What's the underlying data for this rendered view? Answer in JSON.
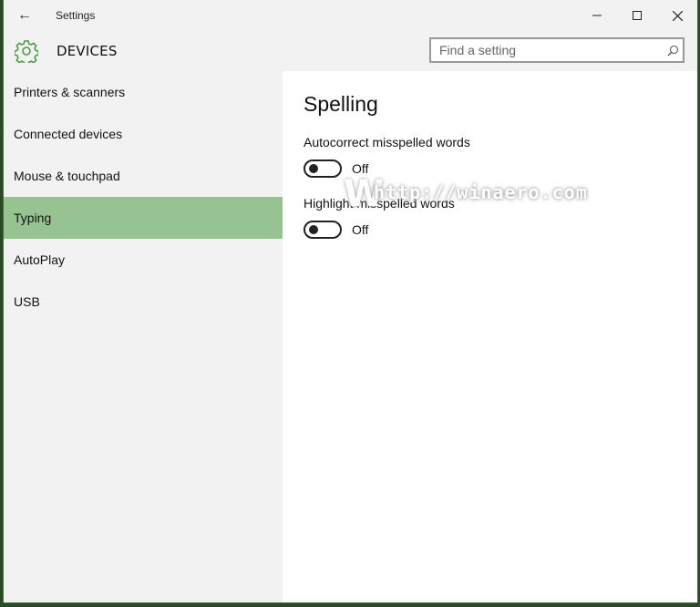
{
  "window": {
    "title": "Settings",
    "back_icon": "arrow-left-icon",
    "minimize": "–",
    "maximize": "☐",
    "close": "✕"
  },
  "header": {
    "section_title": "DEVICES",
    "icon": "gear-icon",
    "accent": "#4c9a44"
  },
  "search": {
    "placeholder": "Find a setting",
    "value": ""
  },
  "sidebar": {
    "items": [
      {
        "label": "Printers & scanners"
      },
      {
        "label": "Connected devices"
      },
      {
        "label": "Mouse & touchpad"
      },
      {
        "label": "Typing",
        "selected": true
      },
      {
        "label": "AutoPlay"
      },
      {
        "label": "USB"
      }
    ],
    "selected_color": "#97c392"
  },
  "main": {
    "heading": "Spelling",
    "settings": [
      {
        "label": "Autocorrect misspelled words",
        "state": "Off"
      },
      {
        "label": "Highlight misspelled words",
        "state": "Off"
      }
    ]
  },
  "watermark": {
    "letter": "W",
    "text": "http://winaero.com"
  }
}
